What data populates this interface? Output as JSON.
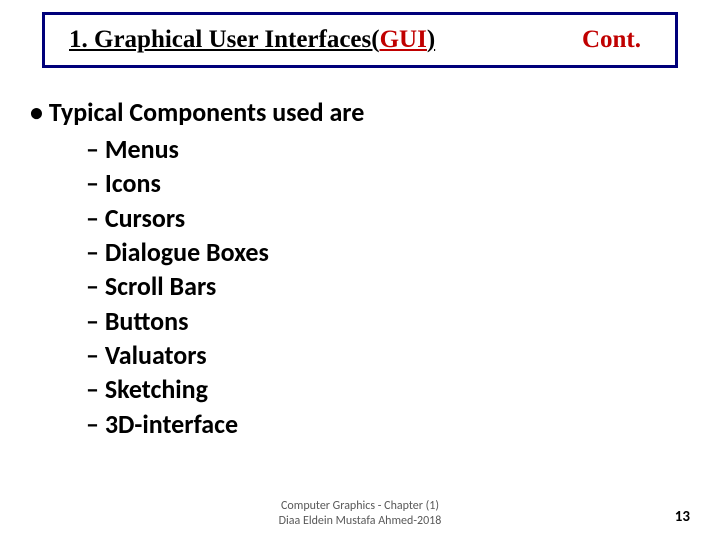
{
  "title": {
    "prefix": "1. Graphical User Interfaces(",
    "gui": "GUI",
    "suffix": ")",
    "cont": "Cont."
  },
  "main_bullet": "Typical Components used are",
  "sub_items": [
    "Menus",
    "Icons",
    "Cursors",
    "Dialogue  Boxes",
    "Scroll Bars",
    "Buttons",
    "Valuators",
    "Sketching",
    "3D-interface"
  ],
  "footer_line1": "Computer Graphics - Chapter (1)",
  "footer_line2": "Diaa Eldein Mustafa Ahmed-2018",
  "page_number": "13"
}
